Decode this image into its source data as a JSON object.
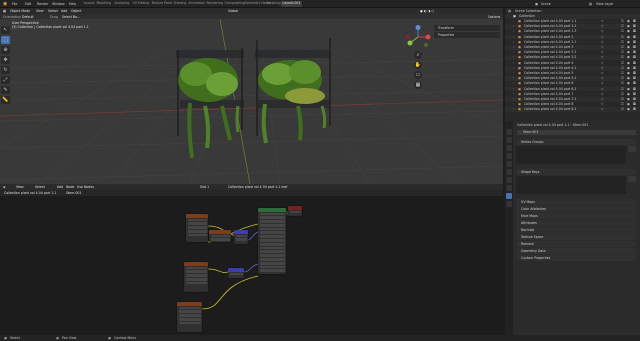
{
  "topbar": {
    "menus": [
      "File",
      "Edit",
      "Render",
      "Window",
      "Help"
    ],
    "workspaces": [
      "Layout",
      "Modeling",
      "Sculpting",
      "UV Editing",
      "Texture Paint",
      "Shading",
      "Animation",
      "Rendering",
      "Compositing",
      "Geometry Nodes",
      "Scripting",
      "Layout.001"
    ],
    "active_workspace": "Layout.001",
    "scene": "Scene",
    "view_layer": "View Layer"
  },
  "viewport": {
    "mode": "Object Mode",
    "menus": [
      "View",
      "Select",
      "Add",
      "Object"
    ],
    "orientation": "Global",
    "transform_label": "Orientation",
    "default_label": "Default",
    "drag_label": "Drag",
    "select_label": "Select Bo...",
    "options_label": "Options",
    "overlay_line1": "User Perspective",
    "overlay_line2": "(3) Collection | Collection plant vol 4.04 part 1.1",
    "n_panel_tabs": [
      "Transform",
      "Properties"
    ]
  },
  "node_editor": {
    "menus": [
      "View",
      "Select",
      "Add",
      "Node",
      "Use Nodes"
    ],
    "material_slot": "Slot 1",
    "material_name": "Collection plant vol 4 04 part 1.1 leaf",
    "breadcrumb_object": "Collection plant vol 4.04 part 1.1",
    "breadcrumb_material": "Stem.001",
    "nodes": [
      {
        "name": "Image Texture",
        "color": "#7b3d1c"
      },
      {
        "name": "Image Texture",
        "color": "#7b3d1c"
      },
      {
        "name": "Image Texture",
        "color": "#7b3d1c"
      },
      {
        "name": "Image Texture",
        "color": "#7b3d1c"
      },
      {
        "name": "Principled BSDF",
        "color": "#2b6e3a"
      },
      {
        "name": "Material Output",
        "color": "#7a1f1f"
      },
      {
        "name": "Normal Map",
        "color": "#3d3db0"
      },
      {
        "name": "Bump",
        "color": "#3d3db0"
      }
    ]
  },
  "outliner": {
    "title": "Scene Collection",
    "root": "Collection",
    "items": [
      "Collection plant vol 4.04 part 1.1",
      "Collection plant vol 4.04 part 1.2",
      "Collection plant vol 4.04 part 1.3",
      "Collection plant vol 4.04 part 2",
      "Collection plant vol 4.04 part 2.1",
      "Collection plant vol 4.04 part 3",
      "Collection plant vol 4.04 part 3.1",
      "Collection plant vol 4.04 part 3.2",
      "Collection plant vol 4.04 part 4",
      "Collection plant vol 4.04 part 4.1",
      "Collection plant vol 4.04 part 5",
      "Collection plant vol 4.04 part 5.1",
      "Collection plant vol 4.04 part 6",
      "Collection plant vol 4.04 part 6.1",
      "Collection plant vol 4.04 part 7",
      "Collection plant vol 4.04 part 7.1",
      "Collection plant vol 4.04 part 8",
      "Collection plant vol 4.04 part 8.1"
    ]
  },
  "properties": {
    "breadcrumb_object": "Collection plant vol 4.04 part 1.1",
    "breadcrumb_material": "Stem.001",
    "material_field": "Stem.001",
    "panels": [
      "Vertex Groups",
      "Shape Keys",
      "UV Maps",
      "Color Attributes",
      "Face Maps",
      "Attributes",
      "Normals",
      "Texture Space",
      "Remesh",
      "Geometry Data",
      "Custom Properties"
    ],
    "active_panel": "Attributes"
  },
  "statusbar": {
    "left": "Select",
    "middle": "Pan View",
    "right": "Context Menu"
  },
  "colors": {
    "accent": "#4772b3",
    "viewport_bg": "#393939",
    "node_bg": "#1c1c1c"
  }
}
